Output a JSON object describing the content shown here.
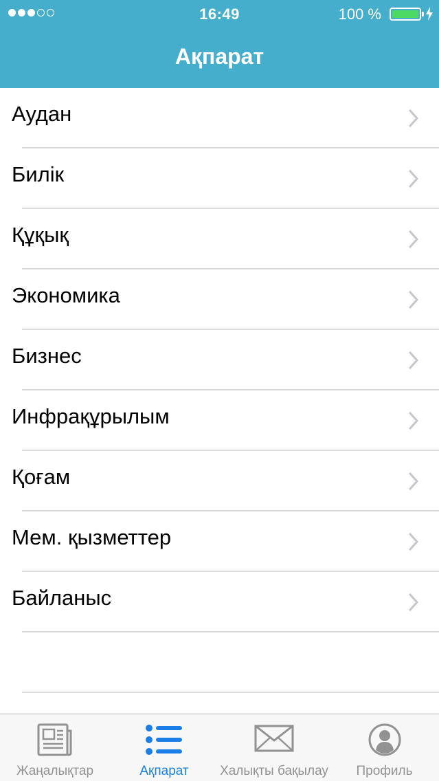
{
  "status_bar": {
    "time": "16:49",
    "battery_percent": "100 %",
    "signal_filled": 3,
    "signal_total": 5
  },
  "nav": {
    "title": "Ақпарат"
  },
  "list": {
    "items": [
      {
        "label": "Аудан"
      },
      {
        "label": "Билік"
      },
      {
        "label": "Құқық"
      },
      {
        "label": "Экономика"
      },
      {
        "label": "Бизнес"
      },
      {
        "label": "Инфрақұрылым"
      },
      {
        "label": "Қоғам"
      },
      {
        "label": "Мем. қызметтер"
      },
      {
        "label": "Байланыс"
      }
    ]
  },
  "tab_bar": {
    "tabs": [
      {
        "label": "Жаңалықтар",
        "icon": "newspaper-icon",
        "active": false
      },
      {
        "label": "Ақпарат",
        "icon": "list-icon",
        "active": true
      },
      {
        "label": "Халықты бақылау",
        "icon": "envelope-icon",
        "active": false
      },
      {
        "label": "Профиль",
        "icon": "profile-icon",
        "active": false
      }
    ]
  },
  "colors": {
    "header": "#45aecd",
    "active_tab": "#1a7ee6",
    "inactive_tab": "#929292",
    "battery": "#4cd964"
  }
}
